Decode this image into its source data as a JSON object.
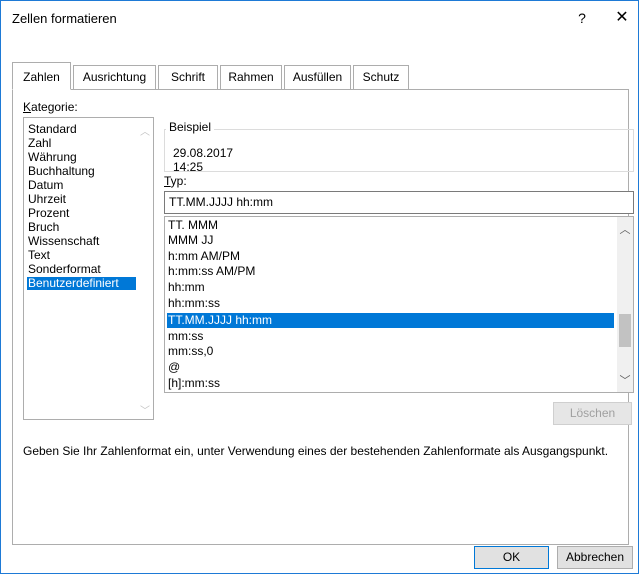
{
  "window": {
    "title": "Zellen formatieren",
    "help_label": "?",
    "close_label": "✕"
  },
  "tabs": [
    {
      "label": "Zahlen",
      "active": true
    },
    {
      "label": "Ausrichtung"
    },
    {
      "label": "Schrift"
    },
    {
      "label": "Rahmen"
    },
    {
      "label": "Ausfüllen"
    },
    {
      "label": "Schutz"
    }
  ],
  "category": {
    "label_first": "K",
    "label_rest": "ategorie:",
    "items": [
      "Standard",
      "Zahl",
      "Währung",
      "Buchhaltung",
      "Datum",
      "Uhrzeit",
      "Prozent",
      "Bruch",
      "Wissenschaft",
      "Text",
      "Sonderformat",
      "Benutzerdefiniert"
    ],
    "selected": "Benutzerdefiniert"
  },
  "sample": {
    "title": "Beispiel",
    "value": "29.08.2017 14:25"
  },
  "type": {
    "label_first": "T",
    "label_rest": "yp:",
    "value": "TT.MM.JJJJ hh:mm",
    "formats": [
      "TT. MMM",
      "MMM JJ",
      "h:mm AM/PM",
      "h:mm:ss AM/PM",
      "hh:mm",
      "hh:mm:ss",
      "TT.MM.JJJJ hh:mm",
      "mm:ss",
      "mm:ss,0",
      "@",
      "[h]:mm:ss"
    ],
    "selected": "TT.MM.JJJJ hh:mm"
  },
  "delete_label": "Löschen",
  "description": "Geben Sie Ihr Zahlenformat ein, unter Verwendung eines der bestehenden Zahlenformate als Ausgangspunkt.",
  "footer": {
    "ok_label": "OK",
    "cancel_label": "Abbrechen"
  },
  "colors": {
    "selection": "#0078d7",
    "window_border": "#1e7ad6"
  }
}
